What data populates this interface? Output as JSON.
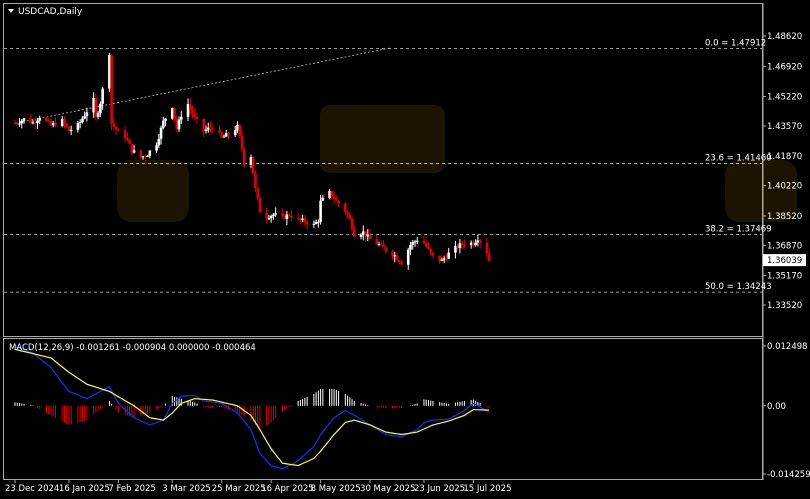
{
  "chart_title": "USDCAD,Daily",
  "colors": {
    "background": "#000000",
    "bull": "#ffffff",
    "bear": "#e00000",
    "grid": "#bbbbbb",
    "fib": "#cccccc",
    "macd_hist_pos": "#ffffff",
    "macd_hist_neg": "#e00000",
    "macd_line": "#1a2cff",
    "signal_line": "#ffff40",
    "price_label_bg": "#ffffff"
  },
  "chart_data": [
    {
      "type": "candlestick",
      "title": "USDCAD,Daily",
      "symbol": "USDCAD",
      "timeframe": "Daily",
      "ylim": [
        1.3352,
        1.4862
      ],
      "y_ticks": [
        "1.48620",
        "1.46920",
        "1.45220",
        "1.43570",
        "1.41870",
        "1.40220",
        "1.38520",
        "1.36870",
        "1.35170",
        "1.33520"
      ],
      "x_ticks": [
        "23 Dec 2024",
        "16 Jan 2025",
        "7 Feb 2025",
        "3 Mar 2025",
        "25 Mar 2025",
        "16 Apr 2025",
        "8 May 2025",
        "30 May 2025",
        "23 Jun 2025",
        "15 Jul 2025"
      ],
      "current_price": "1.36039",
      "fibonacci": [
        {
          "label": "0.0 = 1.47912",
          "value": 1.47912
        },
        {
          "label": "23.6 = 1.41460",
          "value": 1.4146
        },
        {
          "label": "38.2 = 1.37469",
          "value": 1.37469
        },
        {
          "label": "50.0 = 1.34243",
          "value": 1.34243
        }
      ],
      "trendline": {
        "from": {
          "date": "23 Dec 2024",
          "price": 1.4372
        },
        "to": {
          "date": "8 Jun 2025",
          "price": 1.4795
        }
      },
      "close_path": [
        [
          "23 Dec 2024",
          1.4372
        ],
        [
          "27 Dec 2024",
          1.4395
        ],
        [
          "31 Dec 2024",
          1.4375
        ],
        [
          "3 Jan 2025",
          1.441
        ],
        [
          "8 Jan 2025",
          1.436
        ],
        [
          "13 Jan 2025",
          1.4385
        ],
        [
          "16 Jan 2025",
          1.433
        ],
        [
          "20 Jan 2025",
          1.436
        ],
        [
          "23 Jan 2025",
          1.442
        ],
        [
          "27 Jan 2025",
          1.45
        ],
        [
          "28 Jan 2025",
          1.44
        ],
        [
          "30 Jan 2025",
          1.449
        ],
        [
          "3 Feb 2025",
          1.477
        ],
        [
          "4 Feb 2025",
          1.437
        ],
        [
          "7 Feb 2025",
          1.432
        ],
        [
          "10 Feb 2025",
          1.43
        ],
        [
          "13 Feb 2025",
          1.422
        ],
        [
          "17 Feb 2025",
          1.418
        ],
        [
          "20 Feb 2025",
          1.42
        ],
        [
          "24 Feb 2025",
          1.426
        ],
        [
          "27 Feb 2025",
          1.438
        ],
        [
          "3 Mar 2025",
          1.447
        ],
        [
          "5 Mar 2025",
          1.434
        ],
        [
          "7 Mar 2025",
          1.442
        ],
        [
          "10 Mar 2025",
          1.448
        ],
        [
          "13 Mar 2025",
          1.44
        ],
        [
          "17 Mar 2025",
          1.433
        ],
        [
          "21 Mar 2025",
          1.435
        ],
        [
          "25 Mar 2025",
          1.429
        ],
        [
          "28 Mar 2025",
          1.431
        ],
        [
          "1 Apr 2025",
          1.435
        ],
        [
          "3 Apr 2025",
          1.423
        ],
        [
          "4 Apr 2025",
          1.415
        ],
        [
          "7 Apr 2025",
          1.419
        ],
        [
          "9 Apr 2025",
          1.4
        ],
        [
          "11 Apr 2025",
          1.388
        ],
        [
          "14 Apr 2025",
          1.385
        ],
        [
          "17 Apr 2025",
          1.386
        ],
        [
          "21 Apr 2025",
          1.384
        ],
        [
          "24 Apr 2025",
          1.386
        ],
        [
          "28 Apr 2025",
          1.383
        ],
        [
          "1 May 2025",
          1.382
        ],
        [
          "5 May 2025",
          1.38
        ],
        [
          "7 May 2025",
          1.383
        ],
        [
          "8 May 2025",
          1.393
        ],
        [
          "12 May 2025",
          1.398
        ],
        [
          "14 May 2025",
          1.395
        ],
        [
          "19 May 2025",
          1.388
        ],
        [
          "21 May 2025",
          1.383
        ],
        [
          "23 May 2025",
          1.375
        ],
        [
          "27 May 2025",
          1.376
        ],
        [
          "30 May 2025",
          1.372
        ],
        [
          "3 Jun 2025",
          1.369
        ],
        [
          "6 Jun 2025",
          1.366
        ],
        [
          "10 Jun 2025",
          1.363
        ],
        [
          "13 Jun 2025",
          1.359
        ],
        [
          "17 Jun 2025",
          1.369
        ],
        [
          "20 Jun 2025",
          1.372
        ],
        [
          "23 Jun 2025",
          1.37
        ],
        [
          "25 Jun 2025",
          1.366
        ],
        [
          "27 Jun 2025",
          1.362
        ],
        [
          "1 Jul 2025",
          1.36
        ],
        [
          "4 Jul 2025",
          1.364
        ],
        [
          "8 Jul 2025",
          1.368
        ],
        [
          "11 Jul 2025",
          1.37
        ],
        [
          "15 Jul 2025",
          1.37
        ],
        [
          "17 Jul 2025",
          1.373
        ],
        [
          "21 Jul 2025",
          1.365
        ],
        [
          "22 Jul 2025",
          1.3604
        ]
      ]
    },
    {
      "type": "macd",
      "title": "MACD(12,26,9) -0.001261 -0.000904 0.000000 -0.000464",
      "params": "12,26,9",
      "values": {
        "main": "-0.001261",
        "signal": "-0.000904",
        "third": "0.000000",
        "fourth": "-0.000464"
      },
      "ylim": [
        -0.014259,
        0.012498
      ],
      "y_ticks": [
        "0.012498",
        "0.00",
        "-0.014259"
      ],
      "macd_path": [
        [
          "23 Dec 2024",
          0.0125
        ],
        [
          "31 Dec 2024",
          0.011
        ],
        [
          "8 Jan 2025",
          0.008
        ],
        [
          "16 Jan 2025",
          0.003
        ],
        [
          "24 Jan 2025",
          0.0015
        ],
        [
          "3 Feb 2025",
          0.004
        ],
        [
          "7 Feb 2025",
          0.0005
        ],
        [
          "14 Feb 2025",
          -0.0025
        ],
        [
          "21 Feb 2025",
          -0.004
        ],
        [
          "27 Feb 2025",
          -0.003
        ],
        [
          "3 Mar 2025",
          0.0005
        ],
        [
          "7 Mar 2025",
          0.002
        ],
        [
          "13 Mar 2025",
          0.0022
        ],
        [
          "17 Mar 2025",
          0.001
        ],
        [
          "21 Mar 2025",
          0.0008
        ],
        [
          "25 Mar 2025",
          0.0005
        ],
        [
          "1 Apr 2025",
          -0.0015
        ],
        [
          "7 Apr 2025",
          -0.005
        ],
        [
          "11 Apr 2025",
          -0.01
        ],
        [
          "16 Apr 2025",
          -0.0125
        ],
        [
          "21 Apr 2025",
          -0.0132
        ],
        [
          "28 Apr 2025",
          -0.0115
        ],
        [
          "5 May 2025",
          -0.0085
        ],
        [
          "8 May 2025",
          -0.006
        ],
        [
          "14 May 2025",
          -0.0025
        ],
        [
          "19 May 2025",
          -0.001
        ],
        [
          "23 May 2025",
          -0.002
        ],
        [
          "30 May 2025",
          -0.004
        ],
        [
          "6 Jun 2025",
          -0.006
        ],
        [
          "13 Jun 2025",
          -0.0065
        ],
        [
          "20 Jun 2025",
          -0.005
        ],
        [
          "23 Jun 2025",
          -0.0035
        ],
        [
          "27 Jun 2025",
          -0.003
        ],
        [
          "4 Jul 2025",
          -0.0028
        ],
        [
          "11 Jul 2025",
          -0.001
        ],
        [
          "15 Jul 2025",
          0.0005
        ],
        [
          "22 Jul 2025",
          -0.0013
        ]
      ],
      "signal_path": [
        [
          "23 Dec 2024",
          0.0118
        ],
        [
          "8 Jan 2025",
          0.01
        ],
        [
          "16 Jan 2025",
          0.007
        ],
        [
          "24 Jan 2025",
          0.0045
        ],
        [
          "3 Feb 2025",
          0.003
        ],
        [
          "14 Feb 2025",
          0.0
        ],
        [
          "21 Feb 2025",
          -0.0025
        ],
        [
          "27 Feb 2025",
          -0.003
        ],
        [
          "3 Mar 2025",
          -0.0015
        ],
        [
          "7 Mar 2025",
          0.0005
        ],
        [
          "13 Mar 2025",
          0.0015
        ],
        [
          "21 Mar 2025",
          0.0012
        ],
        [
          "1 Apr 2025",
          0.0
        ],
        [
          "7 Apr 2025",
          -0.002
        ],
        [
          "11 Apr 2025",
          -0.005
        ],
        [
          "16 Apr 2025",
          -0.009
        ],
        [
          "21 Apr 2025",
          -0.012
        ],
        [
          "28 Apr 2025",
          -0.0125
        ],
        [
          "5 May 2025",
          -0.011
        ],
        [
          "8 May 2025",
          -0.0095
        ],
        [
          "14 May 2025",
          -0.006
        ],
        [
          "19 May 2025",
          -0.0035
        ],
        [
          "23 May 2025",
          -0.003
        ],
        [
          "30 May 2025",
          -0.004
        ],
        [
          "6 Jun 2025",
          -0.0055
        ],
        [
          "13 Jun 2025",
          -0.006
        ],
        [
          "20 Jun 2025",
          -0.0055
        ],
        [
          "27 Jun 2025",
          -0.004
        ],
        [
          "4 Jul 2025",
          -0.0032
        ],
        [
          "11 Jul 2025",
          -0.002
        ],
        [
          "15 Jul 2025",
          -0.0008
        ],
        [
          "22 Jul 2025",
          -0.0009
        ]
      ]
    }
  ]
}
